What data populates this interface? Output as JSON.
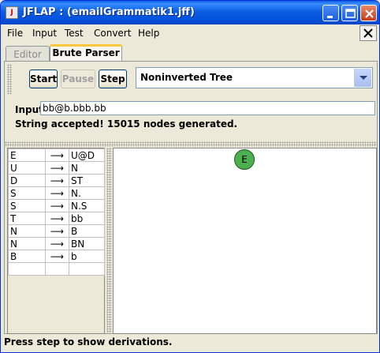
{
  "window": {
    "title": "JFLAP : (emailGrammatik1.jff)"
  },
  "menu": [
    "File",
    "Input",
    "Test",
    "Convert",
    "Help"
  ],
  "tabs": [
    {
      "label": "Editor",
      "active": false
    },
    {
      "label": "Brute Parser",
      "active": true
    }
  ],
  "controls": {
    "start_label": "Start",
    "pause_label": "Pause",
    "step_label": "Step",
    "view_select": "Noninverted Tree"
  },
  "input": {
    "label": "Input",
    "value": "bb@b.bbb.bb"
  },
  "message": "String accepted!  15015 nodes generated.",
  "grammar": {
    "arrow": "⟶",
    "rules": [
      {
        "lhs": "E",
        "rhs": "U@D"
      },
      {
        "lhs": "U",
        "rhs": "N"
      },
      {
        "lhs": "D",
        "rhs": "ST"
      },
      {
        "lhs": "S",
        "rhs": "N."
      },
      {
        "lhs": "S",
        "rhs": "N.S"
      },
      {
        "lhs": "T",
        "rhs": "bb"
      },
      {
        "lhs": "N",
        "rhs": "B"
      },
      {
        "lhs": "N",
        "rhs": "BN"
      },
      {
        "lhs": "B",
        "rhs": "b"
      }
    ]
  },
  "tree": {
    "root_label": "E",
    "node_color": "#4caf50"
  },
  "status_bar": "Press step to show derivations.",
  "colors": {
    "titlebar": "#0b5ee3",
    "tab_highlight": "#ffc83c",
    "node": "#4caf50"
  }
}
